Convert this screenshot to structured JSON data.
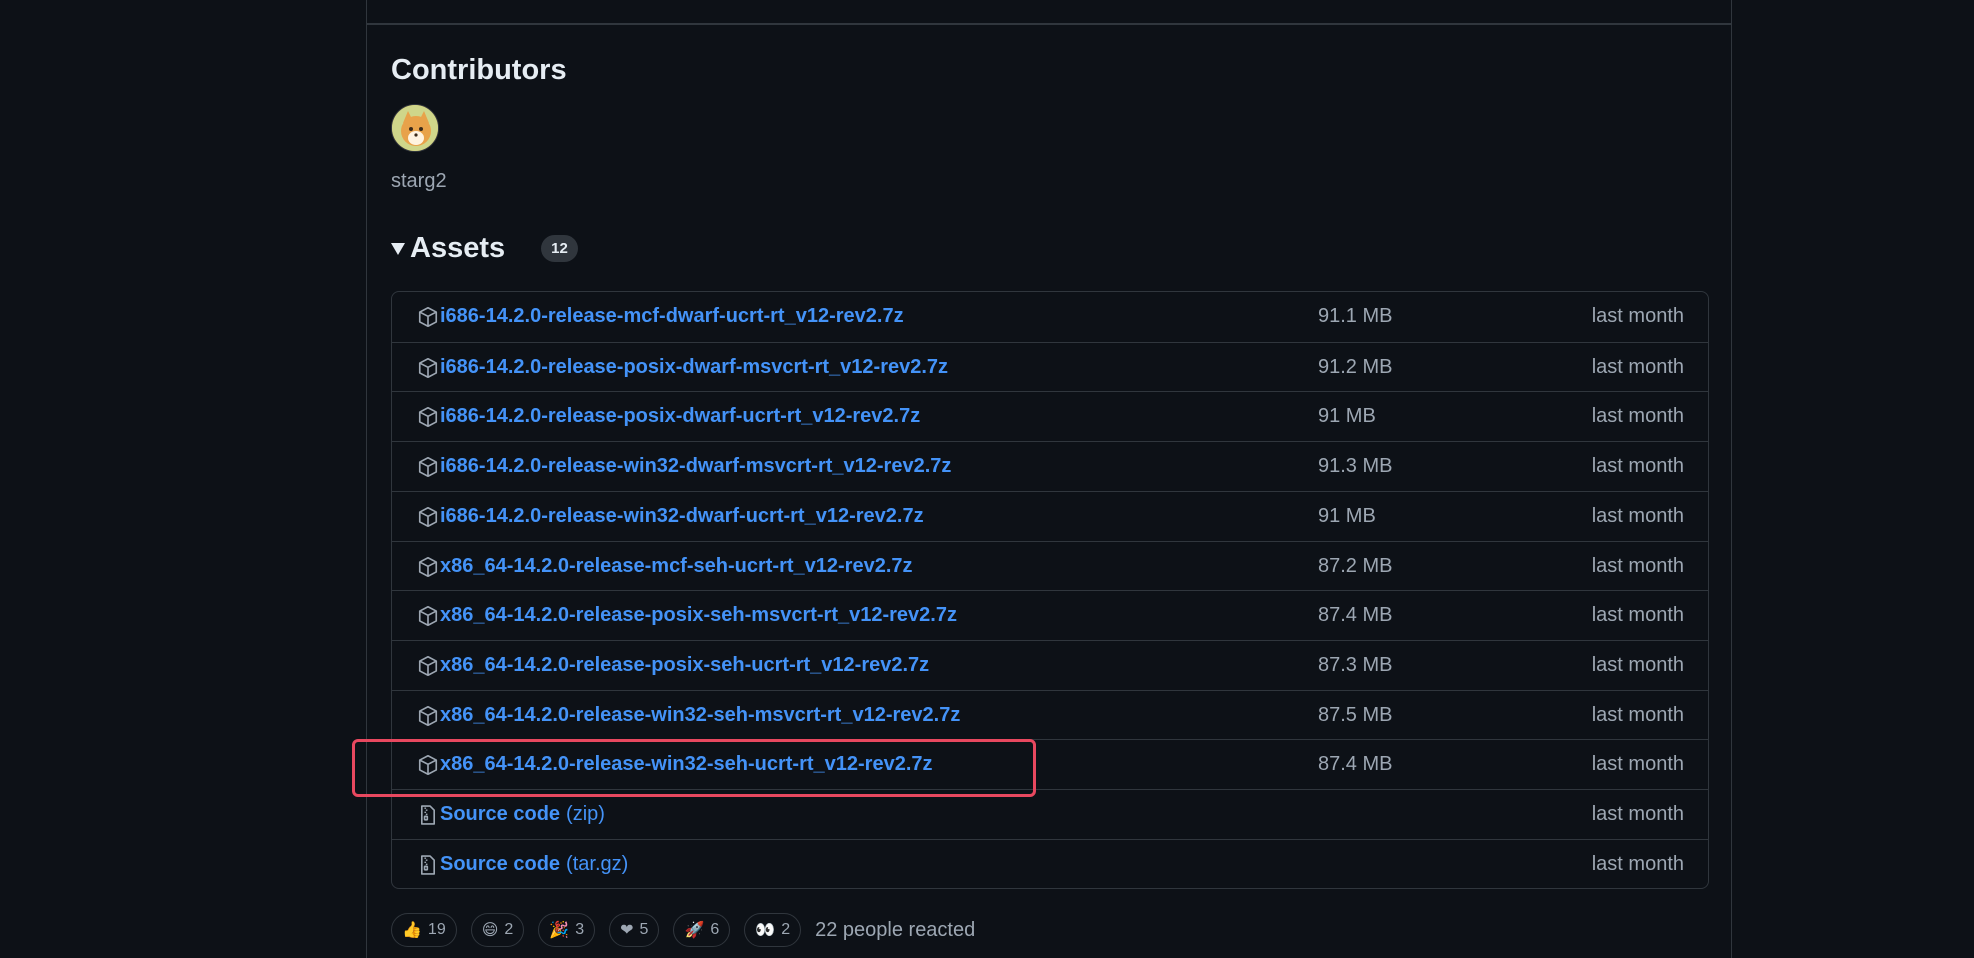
{
  "contributors": {
    "title": "Contributors",
    "users": [
      {
        "name": "starg2"
      }
    ]
  },
  "assets": {
    "title": "Assets",
    "count": "12",
    "rows": [
      {
        "name": "i686-14.2.0-release-mcf-dwarf-ucrt-rt_v12-rev2.7z",
        "size": "91.1 MB",
        "date": "last month",
        "icon": "package-icon"
      },
      {
        "name": "i686-14.2.0-release-posix-dwarf-msvcrt-rt_v12-rev2.7z",
        "size": "91.2 MB",
        "date": "last month",
        "icon": "package-icon"
      },
      {
        "name": "i686-14.2.0-release-posix-dwarf-ucrt-rt_v12-rev2.7z",
        "size": "91 MB",
        "date": "last month",
        "icon": "package-icon"
      },
      {
        "name": "i686-14.2.0-release-win32-dwarf-msvcrt-rt_v12-rev2.7z",
        "size": "91.3 MB",
        "date": "last month",
        "icon": "package-icon"
      },
      {
        "name": "i686-14.2.0-release-win32-dwarf-ucrt-rt_v12-rev2.7z",
        "size": "91 MB",
        "date": "last month",
        "icon": "package-icon"
      },
      {
        "name": "x86_64-14.2.0-release-mcf-seh-ucrt-rt_v12-rev2.7z",
        "size": "87.2 MB",
        "date": "last month",
        "icon": "package-icon"
      },
      {
        "name": "x86_64-14.2.0-release-posix-seh-msvcrt-rt_v12-rev2.7z",
        "size": "87.4 MB",
        "date": "last month",
        "icon": "package-icon"
      },
      {
        "name": "x86_64-14.2.0-release-posix-seh-ucrt-rt_v12-rev2.7z",
        "size": "87.3 MB",
        "date": "last month",
        "icon": "package-icon"
      },
      {
        "name": "x86_64-14.2.0-release-win32-seh-msvcrt-rt_v12-rev2.7z",
        "size": "87.5 MB",
        "date": "last month",
        "icon": "package-icon"
      },
      {
        "name": "x86_64-14.2.0-release-win32-seh-ucrt-rt_v12-rev2.7z",
        "size": "87.4 MB",
        "date": "last month",
        "icon": "package-icon"
      },
      {
        "name": "Source code",
        "ext": "(zip)",
        "size": "",
        "date": "last month",
        "icon": "file-zip-icon"
      },
      {
        "name": "Source code",
        "ext": "(tar.gz)",
        "size": "",
        "date": "last month",
        "icon": "file-zip-icon"
      }
    ]
  },
  "reactions": {
    "items": [
      {
        "emoji": "👍",
        "count": "19"
      },
      {
        "emoji": "😄",
        "count": "2"
      },
      {
        "emoji": "🎉",
        "count": "3"
      },
      {
        "emoji": "❤",
        "count": "5"
      },
      {
        "emoji": "🚀",
        "count": "6"
      },
      {
        "emoji": "👀",
        "count": "2"
      }
    ],
    "summary": "22 people reacted"
  },
  "colors": {
    "background": "#0d1117",
    "link": "#4493f8",
    "muted": "#9da7b3",
    "border": "#30363d",
    "highlight": "#e8485f"
  }
}
